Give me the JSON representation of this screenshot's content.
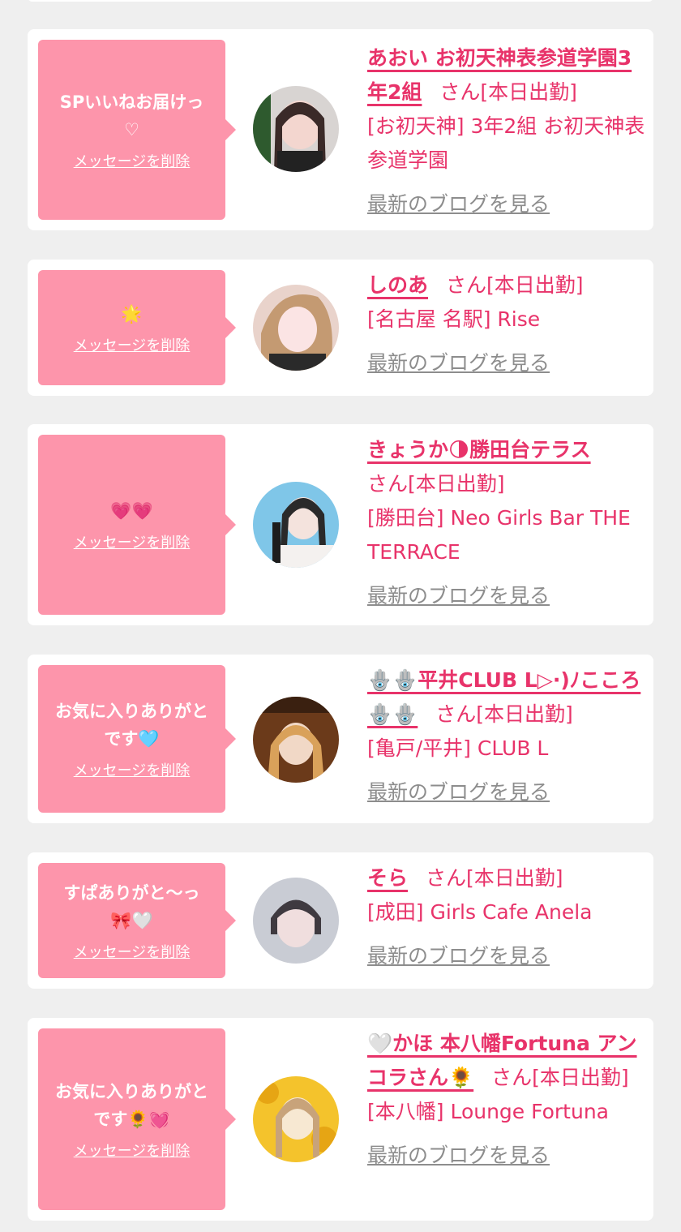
{
  "delete_label": "メッセージを削除",
  "blog_label": "最新のブログを見る",
  "cards": [
    {
      "message": "SPいいねお届けっ♡",
      "name": "あおい お初天神表参道学園3年2組",
      "suffix": "さん[本日出勤]",
      "shop": "[お初天神] 3年2組 お初天神表参道学園",
      "avatar_colors": [
        "#d8d4d2",
        "#3a2a28",
        "#f3d6cf"
      ]
    },
    {
      "message": "🌟",
      "name": "しのあ",
      "suffix": "さん[本日出勤]",
      "shop": "[名古屋 名駅] Rise",
      "avatar_colors": [
        "#e9d3cb",
        "#c49a72",
        "#fbe4e4"
      ]
    },
    {
      "message": "💗💗",
      "name": "きょうか🌗勝田台テラス",
      "suffix": "さん[本日出勤]",
      "shop": "[勝田台] Neo Girls Bar THE TERRACE",
      "avatar_colors": [
        "#7fc6e8",
        "#2a2a2a",
        "#f4f1ef"
      ]
    },
    {
      "message": "お気に入りありがとです🩵",
      "name": "🪬🪬平井CLUB L▷·)ﾉこころ🪬🪬",
      "suffix": "さん[本日出勤]",
      "shop": "[亀戸/平井] CLUB L",
      "avatar_colors": [
        "#6b3a1a",
        "#d9a15a",
        "#f1d8c6"
      ]
    },
    {
      "message": "すぱありがと〜っ🎀🤍",
      "name": "そら",
      "suffix": "さん[本日出勤]",
      "shop": "[成田] Girls Cafe Anela",
      "avatar_colors": [
        "#c9ccd4",
        "#3f3a40",
        "#f0dede"
      ]
    },
    {
      "message": "お気に入りありがとです🌻💓",
      "name": "🤍かほ 本八幡Fortuna アンコラさん🌻",
      "suffix": "さん[本日出勤]",
      "shop": "[本八幡] Lounge Fortuna",
      "avatar_colors": [
        "#f4c32c",
        "#c8a37a",
        "#f7e8d2"
      ]
    }
  ]
}
